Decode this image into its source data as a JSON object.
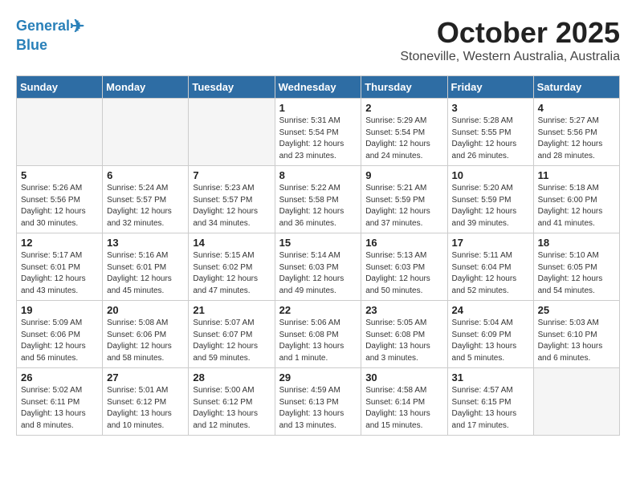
{
  "header": {
    "logo_line1": "General",
    "logo_line2": "Blue",
    "title": "October 2025",
    "subtitle": "Stoneville, Western Australia, Australia"
  },
  "weekdays": [
    "Sunday",
    "Monday",
    "Tuesday",
    "Wednesday",
    "Thursday",
    "Friday",
    "Saturday"
  ],
  "weeks": [
    [
      {
        "day": "",
        "info": ""
      },
      {
        "day": "",
        "info": ""
      },
      {
        "day": "",
        "info": ""
      },
      {
        "day": "1",
        "info": "Sunrise: 5:31 AM\nSunset: 5:54 PM\nDaylight: 12 hours\nand 23 minutes."
      },
      {
        "day": "2",
        "info": "Sunrise: 5:29 AM\nSunset: 5:54 PM\nDaylight: 12 hours\nand 24 minutes."
      },
      {
        "day": "3",
        "info": "Sunrise: 5:28 AM\nSunset: 5:55 PM\nDaylight: 12 hours\nand 26 minutes."
      },
      {
        "day": "4",
        "info": "Sunrise: 5:27 AM\nSunset: 5:56 PM\nDaylight: 12 hours\nand 28 minutes."
      }
    ],
    [
      {
        "day": "5",
        "info": "Sunrise: 5:26 AM\nSunset: 5:56 PM\nDaylight: 12 hours\nand 30 minutes."
      },
      {
        "day": "6",
        "info": "Sunrise: 5:24 AM\nSunset: 5:57 PM\nDaylight: 12 hours\nand 32 minutes."
      },
      {
        "day": "7",
        "info": "Sunrise: 5:23 AM\nSunset: 5:57 PM\nDaylight: 12 hours\nand 34 minutes."
      },
      {
        "day": "8",
        "info": "Sunrise: 5:22 AM\nSunset: 5:58 PM\nDaylight: 12 hours\nand 36 minutes."
      },
      {
        "day": "9",
        "info": "Sunrise: 5:21 AM\nSunset: 5:59 PM\nDaylight: 12 hours\nand 37 minutes."
      },
      {
        "day": "10",
        "info": "Sunrise: 5:20 AM\nSunset: 5:59 PM\nDaylight: 12 hours\nand 39 minutes."
      },
      {
        "day": "11",
        "info": "Sunrise: 5:18 AM\nSunset: 6:00 PM\nDaylight: 12 hours\nand 41 minutes."
      }
    ],
    [
      {
        "day": "12",
        "info": "Sunrise: 5:17 AM\nSunset: 6:01 PM\nDaylight: 12 hours\nand 43 minutes."
      },
      {
        "day": "13",
        "info": "Sunrise: 5:16 AM\nSunset: 6:01 PM\nDaylight: 12 hours\nand 45 minutes."
      },
      {
        "day": "14",
        "info": "Sunrise: 5:15 AM\nSunset: 6:02 PM\nDaylight: 12 hours\nand 47 minutes."
      },
      {
        "day": "15",
        "info": "Sunrise: 5:14 AM\nSunset: 6:03 PM\nDaylight: 12 hours\nand 49 minutes."
      },
      {
        "day": "16",
        "info": "Sunrise: 5:13 AM\nSunset: 6:03 PM\nDaylight: 12 hours\nand 50 minutes."
      },
      {
        "day": "17",
        "info": "Sunrise: 5:11 AM\nSunset: 6:04 PM\nDaylight: 12 hours\nand 52 minutes."
      },
      {
        "day": "18",
        "info": "Sunrise: 5:10 AM\nSunset: 6:05 PM\nDaylight: 12 hours\nand 54 minutes."
      }
    ],
    [
      {
        "day": "19",
        "info": "Sunrise: 5:09 AM\nSunset: 6:06 PM\nDaylight: 12 hours\nand 56 minutes."
      },
      {
        "day": "20",
        "info": "Sunrise: 5:08 AM\nSunset: 6:06 PM\nDaylight: 12 hours\nand 58 minutes."
      },
      {
        "day": "21",
        "info": "Sunrise: 5:07 AM\nSunset: 6:07 PM\nDaylight: 12 hours\nand 59 minutes."
      },
      {
        "day": "22",
        "info": "Sunrise: 5:06 AM\nSunset: 6:08 PM\nDaylight: 13 hours\nand 1 minute."
      },
      {
        "day": "23",
        "info": "Sunrise: 5:05 AM\nSunset: 6:08 PM\nDaylight: 13 hours\nand 3 minutes."
      },
      {
        "day": "24",
        "info": "Sunrise: 5:04 AM\nSunset: 6:09 PM\nDaylight: 13 hours\nand 5 minutes."
      },
      {
        "day": "25",
        "info": "Sunrise: 5:03 AM\nSunset: 6:10 PM\nDaylight: 13 hours\nand 6 minutes."
      }
    ],
    [
      {
        "day": "26",
        "info": "Sunrise: 5:02 AM\nSunset: 6:11 PM\nDaylight: 13 hours\nand 8 minutes."
      },
      {
        "day": "27",
        "info": "Sunrise: 5:01 AM\nSunset: 6:12 PM\nDaylight: 13 hours\nand 10 minutes."
      },
      {
        "day": "28",
        "info": "Sunrise: 5:00 AM\nSunset: 6:12 PM\nDaylight: 13 hours\nand 12 minutes."
      },
      {
        "day": "29",
        "info": "Sunrise: 4:59 AM\nSunset: 6:13 PM\nDaylight: 13 hours\nand 13 minutes."
      },
      {
        "day": "30",
        "info": "Sunrise: 4:58 AM\nSunset: 6:14 PM\nDaylight: 13 hours\nand 15 minutes."
      },
      {
        "day": "31",
        "info": "Sunrise: 4:57 AM\nSunset: 6:15 PM\nDaylight: 13 hours\nand 17 minutes."
      },
      {
        "day": "",
        "info": ""
      }
    ]
  ]
}
